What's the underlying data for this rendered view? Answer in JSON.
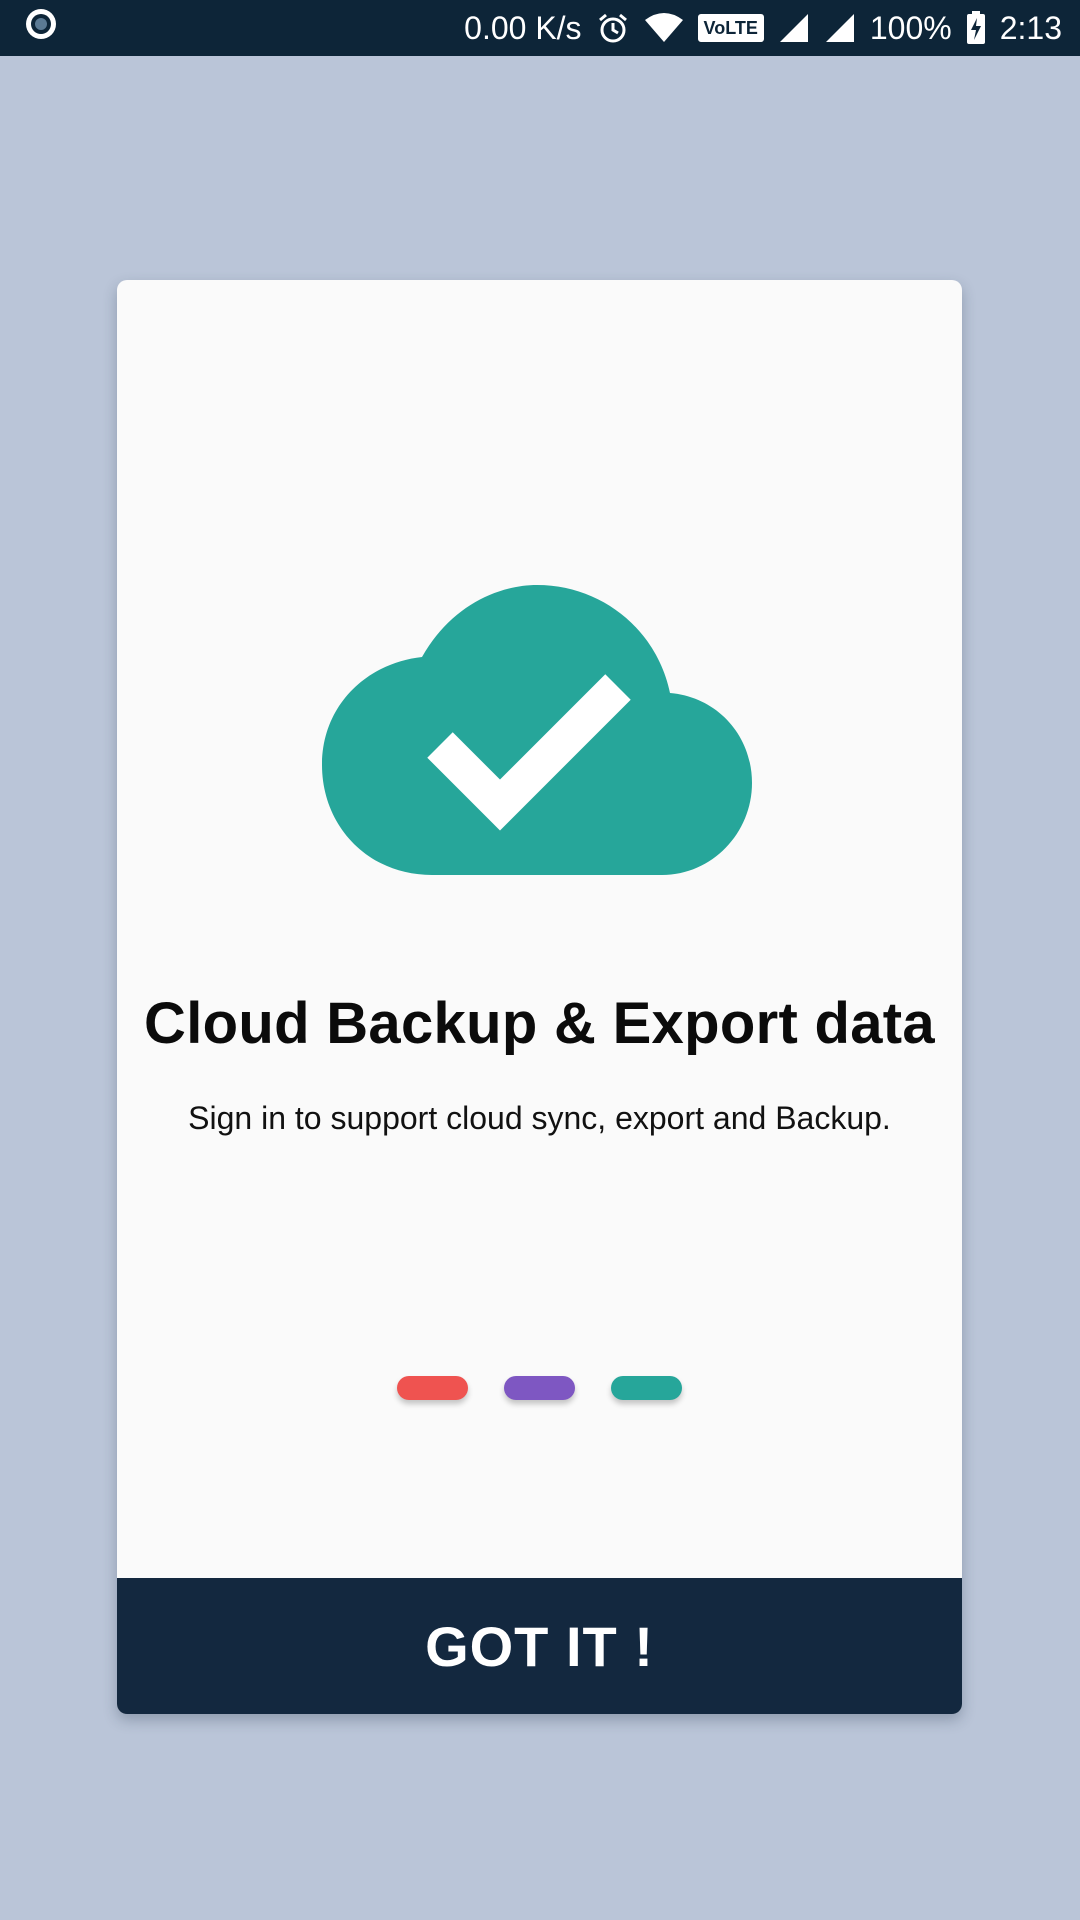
{
  "status_bar": {
    "network_speed": "0.00 K/s",
    "volte": "VoLTE",
    "battery": "100%",
    "time": "2:13"
  },
  "dialog": {
    "title": "Cloud Backup & Export data",
    "subtitle": "Sign in to support cloud sync, export and Backup.",
    "button_label": "GOT IT !",
    "illustration_icon": "cloud-check-icon",
    "page_indicator": {
      "pages": 3,
      "colors": [
        "#ef5350",
        "#7e57c2",
        "#26a69a"
      ]
    }
  },
  "colors": {
    "background": "#bac5d8",
    "status_bar": "#0d2538",
    "accent": "#26a69a",
    "button": "#13283f"
  }
}
